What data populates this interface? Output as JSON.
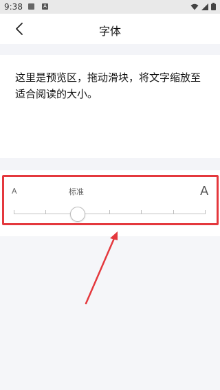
{
  "status_bar": {
    "time": "9:38",
    "a_icon_letter": "A",
    "icons": [
      "image-notification-icon",
      "a-notification-icon",
      "wifi-icon",
      "signal-icon",
      "battery-icon"
    ]
  },
  "app_bar": {
    "title": "字体",
    "back_icon": "chevron-left-icon"
  },
  "preview": {
    "text": "这里是预览区，拖动滑块，将文字缩放至适合阅读的大小。"
  },
  "font_slider": {
    "min_label": "A",
    "current_label": "标准",
    "max_label": "A",
    "step_count": 6,
    "selected_step_index": 2
  },
  "annotation": {
    "highlight_color": "#e4383d"
  }
}
